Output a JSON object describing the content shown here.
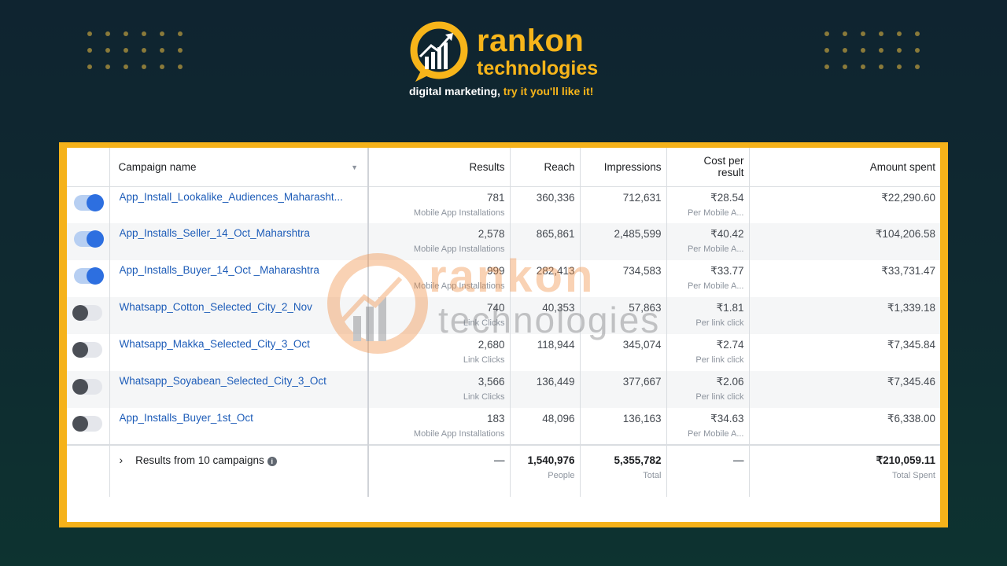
{
  "brand": {
    "name": "rankon",
    "sub": "technologies",
    "tagline_main": "digital marketing,",
    "tagline_accent": " try it you'll like it!"
  },
  "watermark": {
    "name": "rankon",
    "sub": "technologies"
  },
  "table": {
    "headers": {
      "campaign_name": "Campaign name",
      "results": "Results",
      "reach": "Reach",
      "impressions": "Impressions",
      "cost_per_result_line1": "Cost per",
      "cost_per_result_line2": "result",
      "amount_spent": "Amount spent"
    },
    "rows": [
      {
        "toggle": "on",
        "name": "App_Install_Lookalike_Audiences_Maharasht...",
        "results": "781",
        "results_sub": "Mobile App Installations",
        "reach": "360,336",
        "impressions": "712,631",
        "cost": "₹28.54",
        "cost_sub": "Per Mobile A...",
        "spent": "₹22,290.60"
      },
      {
        "toggle": "on",
        "name": "App_Installs_Seller_14_Oct_Maharshtra",
        "results": "2,578",
        "results_sub": "Mobile App Installations",
        "reach": "865,861",
        "impressions": "2,485,599",
        "cost": "₹40.42",
        "cost_sub": "Per Mobile A...",
        "spent": "₹104,206.58"
      },
      {
        "toggle": "on",
        "name": "App_Installs_Buyer_14_Oct _Maharashtra",
        "results": "999",
        "results_sub": "Mobile App Installations",
        "reach": "282,413",
        "impressions": "734,583",
        "cost": "₹33.77",
        "cost_sub": "Per Mobile A...",
        "spent": "₹33,731.47"
      },
      {
        "toggle": "off",
        "name": "Whatsapp_Cotton_Selected_City_2_Nov",
        "results": "740",
        "results_sub": "Link Clicks",
        "reach": "40,353",
        "impressions": "57,863",
        "cost": "₹1.81",
        "cost_sub": "Per link click",
        "spent": "₹1,339.18"
      },
      {
        "toggle": "off",
        "name": "Whatsapp_Makka_Selected_City_3_Oct",
        "results": "2,680",
        "results_sub": "Link Clicks",
        "reach": "118,944",
        "impressions": "345,074",
        "cost": "₹2.74",
        "cost_sub": "Per link click",
        "spent": "₹7,345.84"
      },
      {
        "toggle": "off",
        "name": "Whatsapp_Soyabean_Selected_City_3_Oct",
        "results": "3,566",
        "results_sub": "Link Clicks",
        "reach": "136,449",
        "impressions": "377,667",
        "cost": "₹2.06",
        "cost_sub": "Per link click",
        "spent": "₹7,345.46"
      },
      {
        "toggle": "off",
        "name": "App_Installs_Buyer_1st_Oct",
        "results": "183",
        "results_sub": "Mobile App Installations",
        "reach": "48,096",
        "impressions": "136,163",
        "cost": "₹34.63",
        "cost_sub": "Per Mobile A...",
        "spent": "₹6,338.00"
      }
    ],
    "summary": {
      "label": "Results from 10 campaigns",
      "results": "—",
      "reach": "1,540,976",
      "reach_sub": "People",
      "impressions": "5,355,782",
      "impressions_sub": "Total",
      "cost": "—",
      "spent": "₹210,059.11",
      "spent_sub": "Total Spent"
    }
  },
  "colors": {
    "background": "#0f2430",
    "brand_orange": "#f7b51a",
    "frame": "#f5b21a",
    "link": "#1d5cb8",
    "toggle_on": "#2d6fe0",
    "toggle_off": "#4b4f56"
  }
}
